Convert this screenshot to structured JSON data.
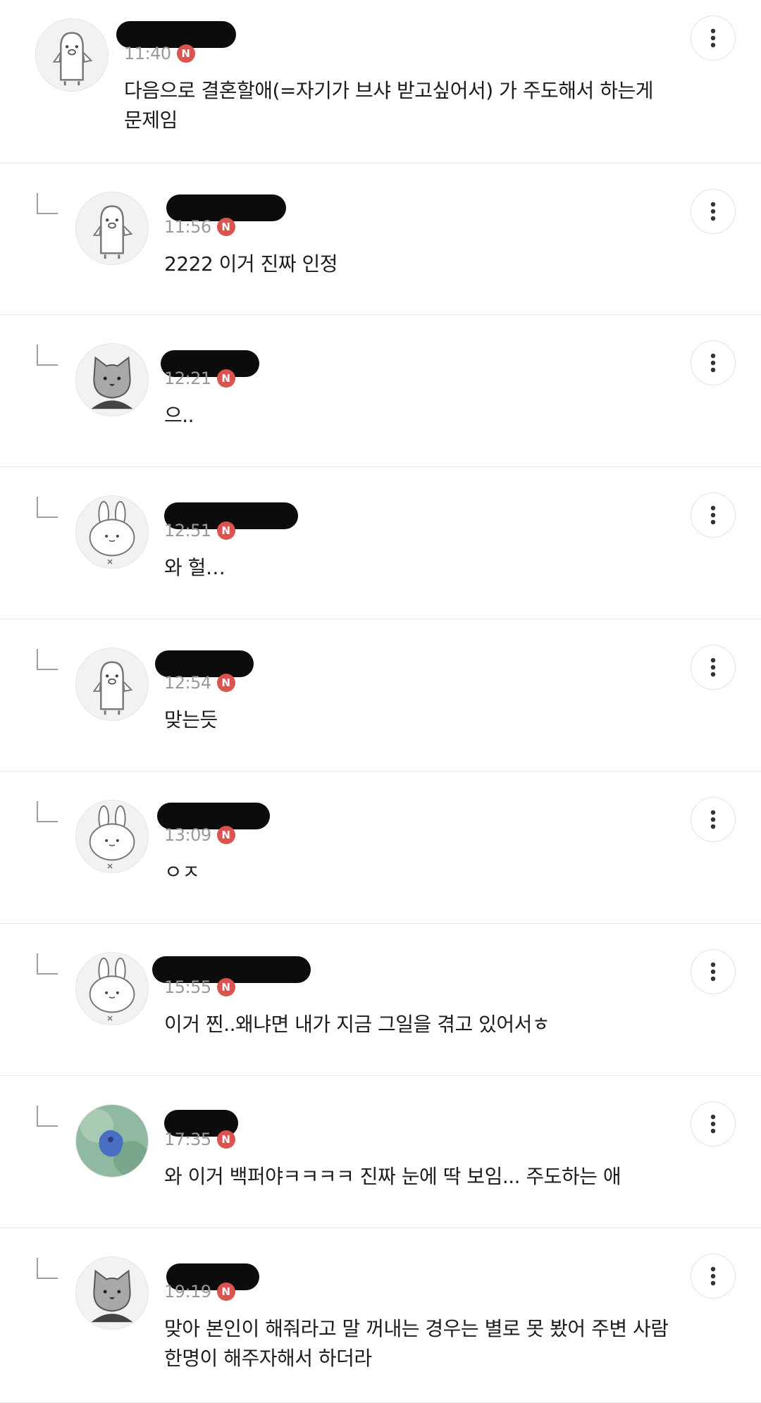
{
  "comments": [
    {
      "name": "",
      "time": "11:40",
      "badge": "N",
      "text": "다음으로 결혼할애(=자기가 브샤 받고싶어서) 가 주도해서 하는게\n문제임",
      "avatar_icon": "penguin-avatar-icon",
      "is_reply": false
    },
    {
      "name": "",
      "time": "11:56",
      "badge": "N",
      "text": "2222 이거 진짜 인정",
      "avatar_icon": "penguin-avatar-icon",
      "is_reply": true
    },
    {
      "name": "",
      "time": "12:21",
      "badge": "N",
      "text": "으..",
      "avatar_icon": "cat-avatar-icon",
      "is_reply": true
    },
    {
      "name": "",
      "time": "12:51",
      "badge": "N",
      "text": "와 헐…",
      "avatar_icon": "rabbit-avatar-icon",
      "is_reply": true
    },
    {
      "name": "",
      "time": "12:54",
      "badge": "N",
      "text": "맞는듯",
      "avatar_icon": "penguin-avatar-icon",
      "is_reply": true
    },
    {
      "name": "",
      "time": "13:09",
      "badge": "N",
      "text": "ㅇㅈ",
      "avatar_icon": "rabbit-avatar-icon",
      "is_reply": true
    },
    {
      "name": "",
      "time": "15:55",
      "badge": "N",
      "text": "이거 찐..왜냐면 내가 지금 그일을 겪고 있어서ㅎ",
      "avatar_icon": "rabbit-avatar-icon",
      "is_reply": true
    },
    {
      "name": "",
      "time": "17:35",
      "badge": "N",
      "text": "와 이거 백퍼야ㅋㅋㅋㅋ 진짜 눈에 딱 보임... 주도하는 애",
      "avatar_icon": "photo-avatar-icon",
      "is_reply": true
    },
    {
      "name": "",
      "time": "19:19",
      "badge": "N",
      "text": "맞아 본인이 해줘라고 말 꺼내는 경우는 별로 못 봤어 주변 사람\n한명이 해주자해서 하더라",
      "avatar_icon": "cat-avatar-icon",
      "is_reply": true
    }
  ],
  "more_icon": "more-vertical-icon",
  "reply_icon": "reply-arrow-icon",
  "colors": {
    "badge": "#d9534f",
    "divider": "#e6e6e6",
    "time": "#9a9a9a",
    "text": "#1c1c1c"
  }
}
